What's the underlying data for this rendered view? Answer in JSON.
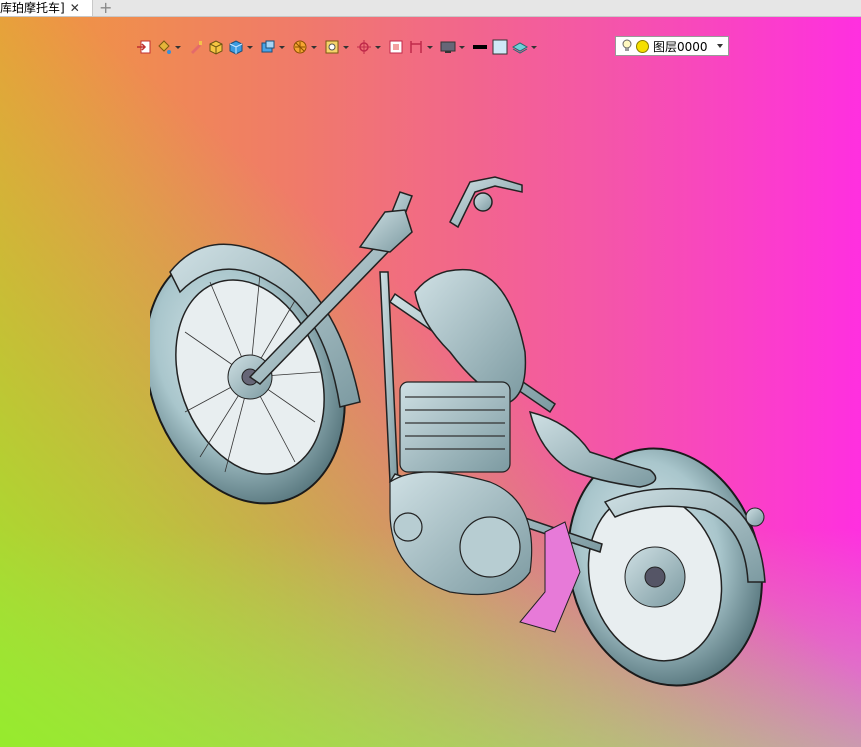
{
  "tab": {
    "title": "库珀摩托车]",
    "close": "✕",
    "add": "+"
  },
  "toolbar": {
    "items": [
      {
        "icon": "exit-icon",
        "dropdown": false
      },
      {
        "icon": "paint-bucket-icon",
        "dropdown": true
      },
      {
        "icon": "brush-icon",
        "dropdown": false
      },
      {
        "icon": "box-render-icon",
        "dropdown": false
      },
      {
        "icon": "cube-icon",
        "dropdown": true
      },
      {
        "icon": "view-cube-icon",
        "dropdown": true
      },
      {
        "icon": "section-icon",
        "dropdown": true
      },
      {
        "icon": "zoom-window-icon",
        "dropdown": true
      },
      {
        "icon": "pan-icon",
        "dropdown": true
      },
      {
        "icon": "fit-view-icon",
        "dropdown": false
      },
      {
        "icon": "dimension-icon",
        "dropdown": true
      },
      {
        "icon": "monitor-icon",
        "dropdown": true
      },
      {
        "icon": "line-color-icon",
        "dropdown": false
      },
      {
        "icon": "fill-color-icon",
        "dropdown": false
      },
      {
        "icon": "layer-stack-icon",
        "dropdown": true
      }
    ],
    "layer": {
      "name": "图层0000"
    }
  },
  "colors": {
    "model": "#a9c6cc",
    "accent_pink": "#e77ad8"
  }
}
